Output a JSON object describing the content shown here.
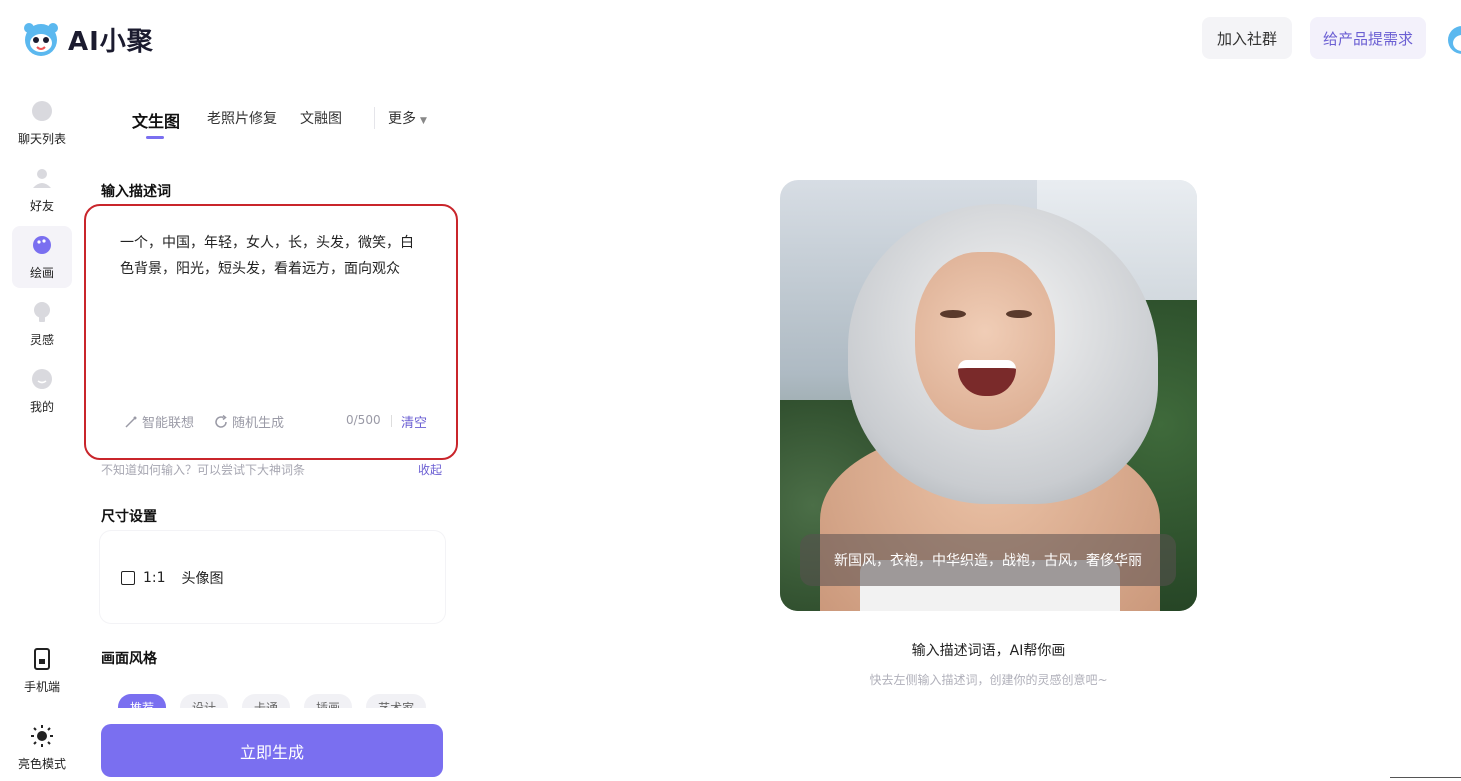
{
  "app": {
    "logo_text": "AI小聚"
  },
  "header": {
    "join_label": "加入社群",
    "feedback_label": "给产品提需求"
  },
  "sidebar": {
    "items": [
      {
        "label": "聊天列表",
        "icon": "chat-bubble-icon"
      },
      {
        "label": "好友",
        "icon": "person-icon"
      },
      {
        "label": "绘画",
        "icon": "palette-icon"
      },
      {
        "label": "灵感",
        "icon": "lightbulb-icon"
      },
      {
        "label": "我的",
        "icon": "smiley-icon"
      }
    ],
    "bottom": [
      {
        "label": "手机端",
        "icon": "phone-icon"
      },
      {
        "label": "亮色模式",
        "icon": "sun-icon"
      }
    ]
  },
  "tabs": {
    "items": [
      "文生图",
      "老照片修复",
      "文融图"
    ],
    "more": "更多"
  },
  "prompt": {
    "title": "输入描述词",
    "text": "一个，中国，年轻，女人，长，头发，微笑，白色背景，阳光，短头发，看着远方，面向观众",
    "smart_label": "智能联想",
    "random_label": "随机生成",
    "counter": "0/500",
    "clear_label": "清空",
    "hint": "不知道如何输入？可以尝试下大神词条",
    "collapse_label": "收起"
  },
  "size": {
    "title": "尺寸设置",
    "ratio": "1:1",
    "ratio_name": "头像图"
  },
  "style": {
    "title": "画面风格",
    "chips": [
      "推荐",
      "设计",
      "卡通",
      "插画",
      "艺术家"
    ]
  },
  "generate_label": "立即生成",
  "preview": {
    "caption": "新国风，衣袍，中华织造，战袍，古风，奢侈华丽",
    "title": "输入描述词语，AI帮你画",
    "subtitle": "快去左侧输入描述词，创建你的灵感创意吧~"
  },
  "colors": {
    "accent": "#7a6ff0",
    "highlight_border": "#c9252b"
  }
}
